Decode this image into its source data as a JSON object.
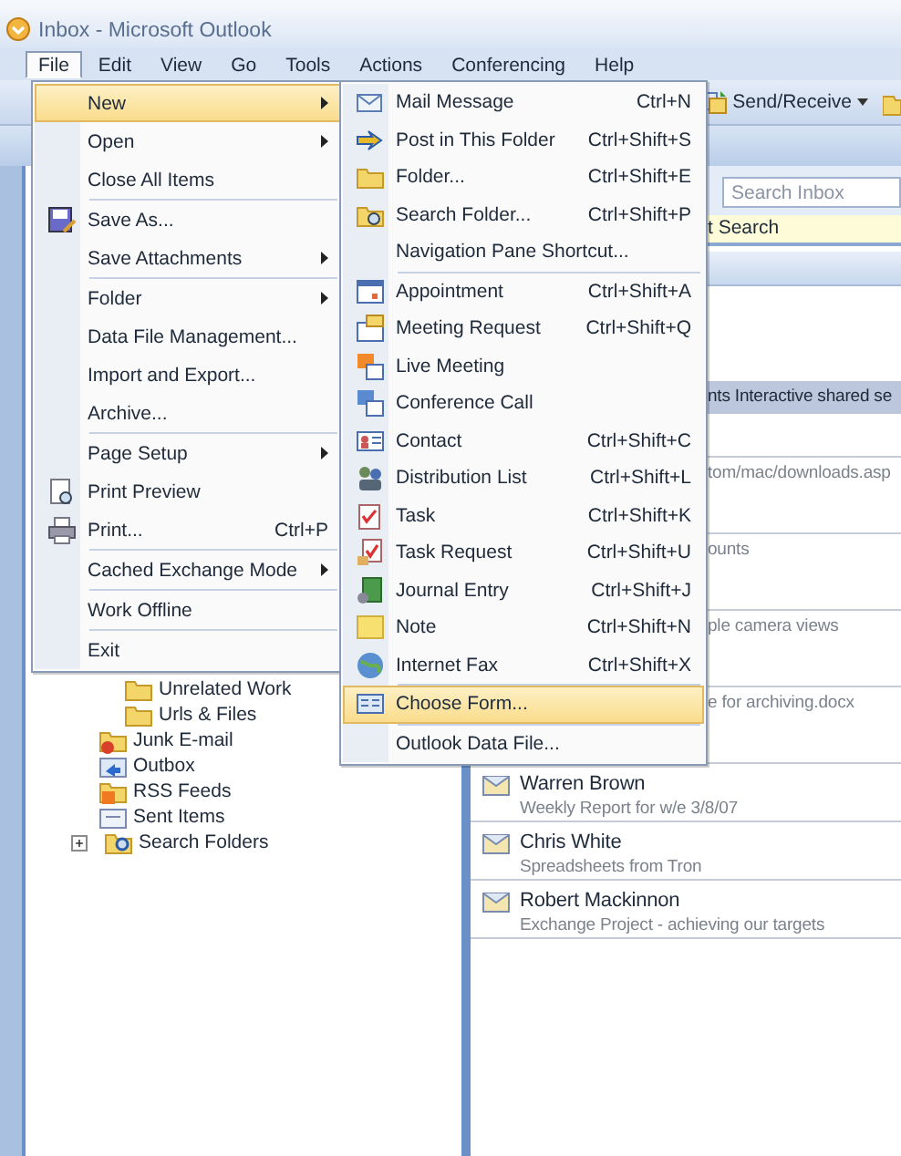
{
  "window": {
    "title": "Inbox - Microsoft Outlook"
  },
  "menubar": [
    {
      "label": "File",
      "selected": true
    },
    {
      "label": "Edit",
      "selected": false
    },
    {
      "label": "View",
      "selected": false
    },
    {
      "label": "Go",
      "selected": false
    },
    {
      "label": "Tools",
      "selected": false
    },
    {
      "label": "Actions",
      "selected": false
    },
    {
      "label": "Conferencing",
      "selected": false
    },
    {
      "label": "Help",
      "selected": false
    }
  ],
  "toolbar": {
    "send_receive": "Send/Receive"
  },
  "file_menu": {
    "groups": [
      [
        {
          "label": "New",
          "submenu": true,
          "selected": true
        },
        {
          "label": "Open",
          "submenu": true,
          "selected": false
        },
        {
          "label": "Close All Items",
          "submenu": false,
          "selected": false
        }
      ],
      [
        {
          "label": "Save As...",
          "submenu": false,
          "selected": false
        },
        {
          "label": "Save Attachments",
          "submenu": true,
          "selected": false
        }
      ],
      [
        {
          "label": "Folder",
          "submenu": true,
          "selected": false
        },
        {
          "label": "Data File Management...",
          "submenu": false,
          "selected": false
        },
        {
          "label": "Import and Export...",
          "submenu": false,
          "selected": false
        },
        {
          "label": "Archive...",
          "submenu": false,
          "selected": false
        }
      ],
      [
        {
          "label": "Page Setup",
          "submenu": true,
          "selected": false
        },
        {
          "label": "Print Preview",
          "submenu": false,
          "selected": false
        },
        {
          "label": "Print...",
          "shortcut": "Ctrl+P",
          "submenu": false,
          "selected": false
        }
      ],
      [
        {
          "label": "Cached Exchange Mode",
          "submenu": true,
          "selected": false
        }
      ],
      [
        {
          "label": "Work Offline",
          "submenu": false,
          "selected": false
        }
      ],
      [
        {
          "label": "Exit",
          "submenu": false,
          "selected": false
        }
      ]
    ]
  },
  "new_submenu": {
    "groups": [
      [
        {
          "label": "Mail Message",
          "shortcut": "Ctrl+N",
          "selected": false
        },
        {
          "label": "Post in This Folder",
          "shortcut": "Ctrl+Shift+S",
          "selected": false
        },
        {
          "label": "Folder...",
          "shortcut": "Ctrl+Shift+E",
          "selected": false
        },
        {
          "label": "Search Folder...",
          "shortcut": "Ctrl+Shift+P",
          "selected": false
        },
        {
          "label": "Navigation Pane Shortcut...",
          "selected": false
        }
      ],
      [
        {
          "label": "Appointment",
          "shortcut": "Ctrl+Shift+A",
          "selected": false
        },
        {
          "label": "Meeting Request",
          "shortcut": "Ctrl+Shift+Q",
          "selected": false
        },
        {
          "label": "Live Meeting",
          "selected": false
        },
        {
          "label": "Conference Call",
          "selected": false
        },
        {
          "label": "Contact",
          "shortcut": "Ctrl+Shift+C",
          "selected": false
        },
        {
          "label": "Distribution List",
          "shortcut": "Ctrl+Shift+L",
          "selected": false
        },
        {
          "label": "Task",
          "shortcut": "Ctrl+Shift+K",
          "selected": false
        },
        {
          "label": "Task Request",
          "shortcut": "Ctrl+Shift+U",
          "selected": false
        },
        {
          "label": "Journal Entry",
          "shortcut": "Ctrl+Shift+J",
          "selected": false
        },
        {
          "label": "Note",
          "shortcut": "Ctrl+Shift+N",
          "selected": false
        },
        {
          "label": "Internet Fax",
          "shortcut": "Ctrl+Shift+X",
          "selected": false
        }
      ],
      [
        {
          "label": "Choose Form...",
          "selected": true
        }
      ],
      [
        {
          "label": "Outlook Data File...",
          "selected": false
        }
      ]
    ]
  },
  "navigation_pane": {
    "folders": [
      {
        "children": [
          {
            "label": "Unrelated Work"
          },
          {
            "label": "Urls & Files"
          }
        ]
      },
      {
        "label": "Junk E-mail"
      },
      {
        "label": "Outbox"
      },
      {
        "label": "RSS Feeds"
      },
      {
        "label": "Sent Items"
      },
      {
        "label": "Search Folders",
        "expanded": false
      }
    ]
  },
  "mail_list": {
    "search": {
      "placeholder": "Search Inbox"
    },
    "hint_bar": "t Search",
    "rows": [
      {
        "subject": "nts Interactive shared se",
        "selected": true
      },
      {
        "subject": "tom/mac/downloads.asp",
        "selected": false
      },
      {
        "subject": "ounts",
        "selected": false
      },
      {
        "subject": "ple camera views",
        "selected": false
      },
      {
        "subject": "e for archiving.docx",
        "selected": false
      },
      {
        "sender": "Warren Brown",
        "subject": "Weekly Report for w/e 3/8/07",
        "selected": false
      },
      {
        "sender": "Chris White",
        "subject": "Spreadsheets from Tron",
        "selected": false
      },
      {
        "sender": "Robert Mackinnon",
        "subject": "Exchange Project - achieving our targets",
        "selected": false
      }
    ]
  }
}
